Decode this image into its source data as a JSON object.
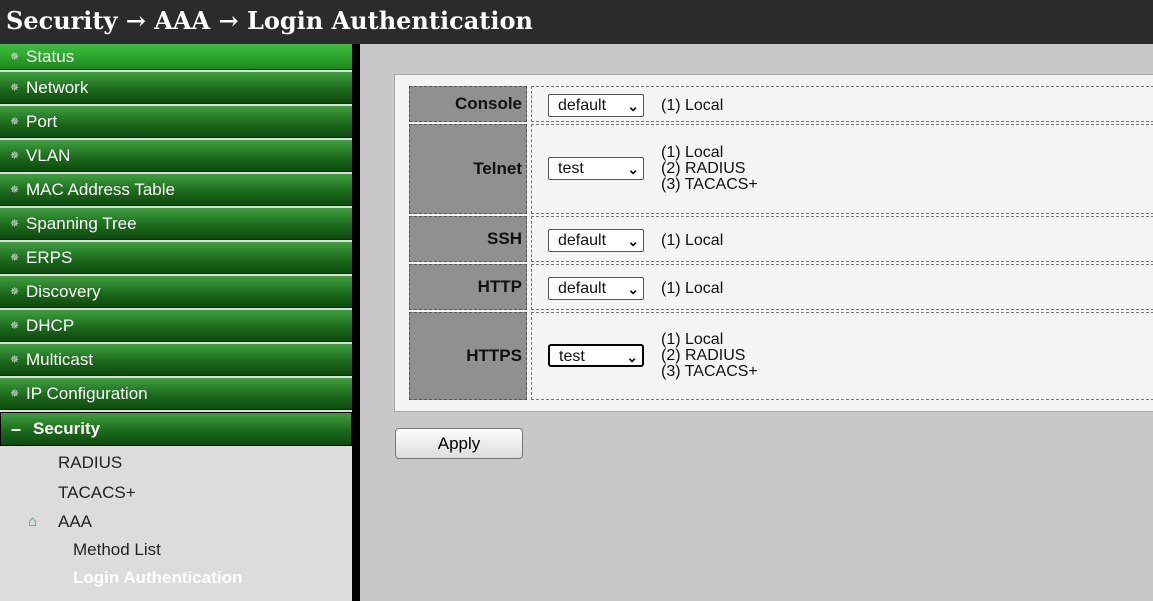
{
  "title": "Security → AAA → Login Authentication",
  "nav": {
    "items": [
      {
        "label": "Status"
      },
      {
        "label": "Network"
      },
      {
        "label": "Port"
      },
      {
        "label": "VLAN"
      },
      {
        "label": "MAC Address Table"
      },
      {
        "label": "Spanning Tree"
      },
      {
        "label": "ERPS"
      },
      {
        "label": "Discovery"
      },
      {
        "label": "DHCP"
      },
      {
        "label": "Multicast"
      },
      {
        "label": "IP Configuration"
      }
    ],
    "security": {
      "label": "Security"
    },
    "sub": {
      "radius": "RADIUS",
      "tacacs": "TACACS+",
      "aaa": "AAA",
      "method_list": "Method List",
      "login_auth": "Login Authentication"
    }
  },
  "rows": {
    "console": {
      "label": "Console",
      "select": "default",
      "methods": [
        "(1) Local"
      ]
    },
    "telnet": {
      "label": "Telnet",
      "select": "test",
      "methods": [
        "(1) Local",
        "(2) RADIUS",
        "(3) TACACS+"
      ]
    },
    "ssh": {
      "label": "SSH",
      "select": "default",
      "methods": [
        "(1) Local"
      ]
    },
    "http": {
      "label": "HTTP",
      "select": "default",
      "methods": [
        "(1) Local"
      ]
    },
    "https": {
      "label": "HTTPS",
      "select": "test",
      "methods": [
        "(1) Local",
        "(2) RADIUS",
        "(3) TACACS+"
      ]
    }
  },
  "apply_label": "Apply"
}
